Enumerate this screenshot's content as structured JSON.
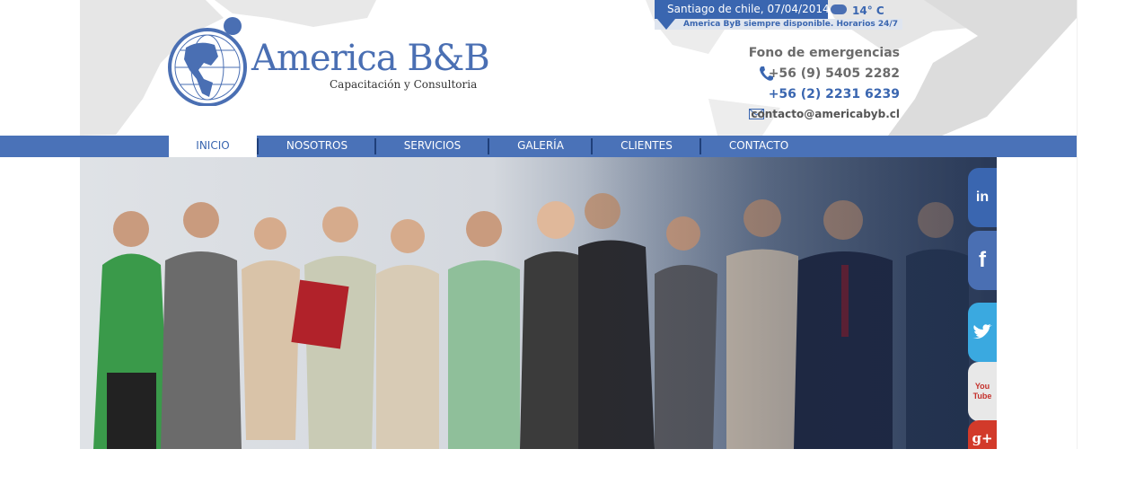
{
  "weather": {
    "location_date": "Santiago de chile, 07/04/2014",
    "temperature": "14° C",
    "notice": "America ByB siempre disponible. Horarios 24/7",
    "icon": "cloud-icon"
  },
  "brand": {
    "name": "America B&B",
    "tagline": "Capacitación y Consultoria"
  },
  "contact": {
    "emergency_label": "Fono de emergencias",
    "phone_1": "+56 (9) 5405 2282",
    "phone_2": "+56 (2) 2231 6239",
    "email": "contacto@americabyb.cl"
  },
  "nav": {
    "items": [
      {
        "label": "INICIO",
        "active": true
      },
      {
        "label": "NOSOTROS",
        "active": false
      },
      {
        "label": "SERVICIOS",
        "active": false
      },
      {
        "label": "GALERÍA",
        "active": false
      },
      {
        "label": "CLIENTES",
        "active": false
      },
      {
        "label": "CONTACTO",
        "active": false
      }
    ]
  },
  "social": [
    {
      "name": "linkedin-icon",
      "glyph": "in",
      "color": "#3a66b0"
    },
    {
      "name": "facebook-icon",
      "glyph": "f",
      "color": "#4a6fb3"
    },
    {
      "name": "twitter-icon",
      "glyph": "🐦",
      "color": "#3aa9e0"
    },
    {
      "name": "youtube-icon",
      "glyph": "You Tube",
      "color": "#e8e8e8"
    },
    {
      "name": "googleplus-icon",
      "glyph": "g+",
      "color": "#d23a2a"
    }
  ],
  "colors": {
    "brand_blue": "#3a66b0",
    "nav_blue": "#4a72b8"
  }
}
